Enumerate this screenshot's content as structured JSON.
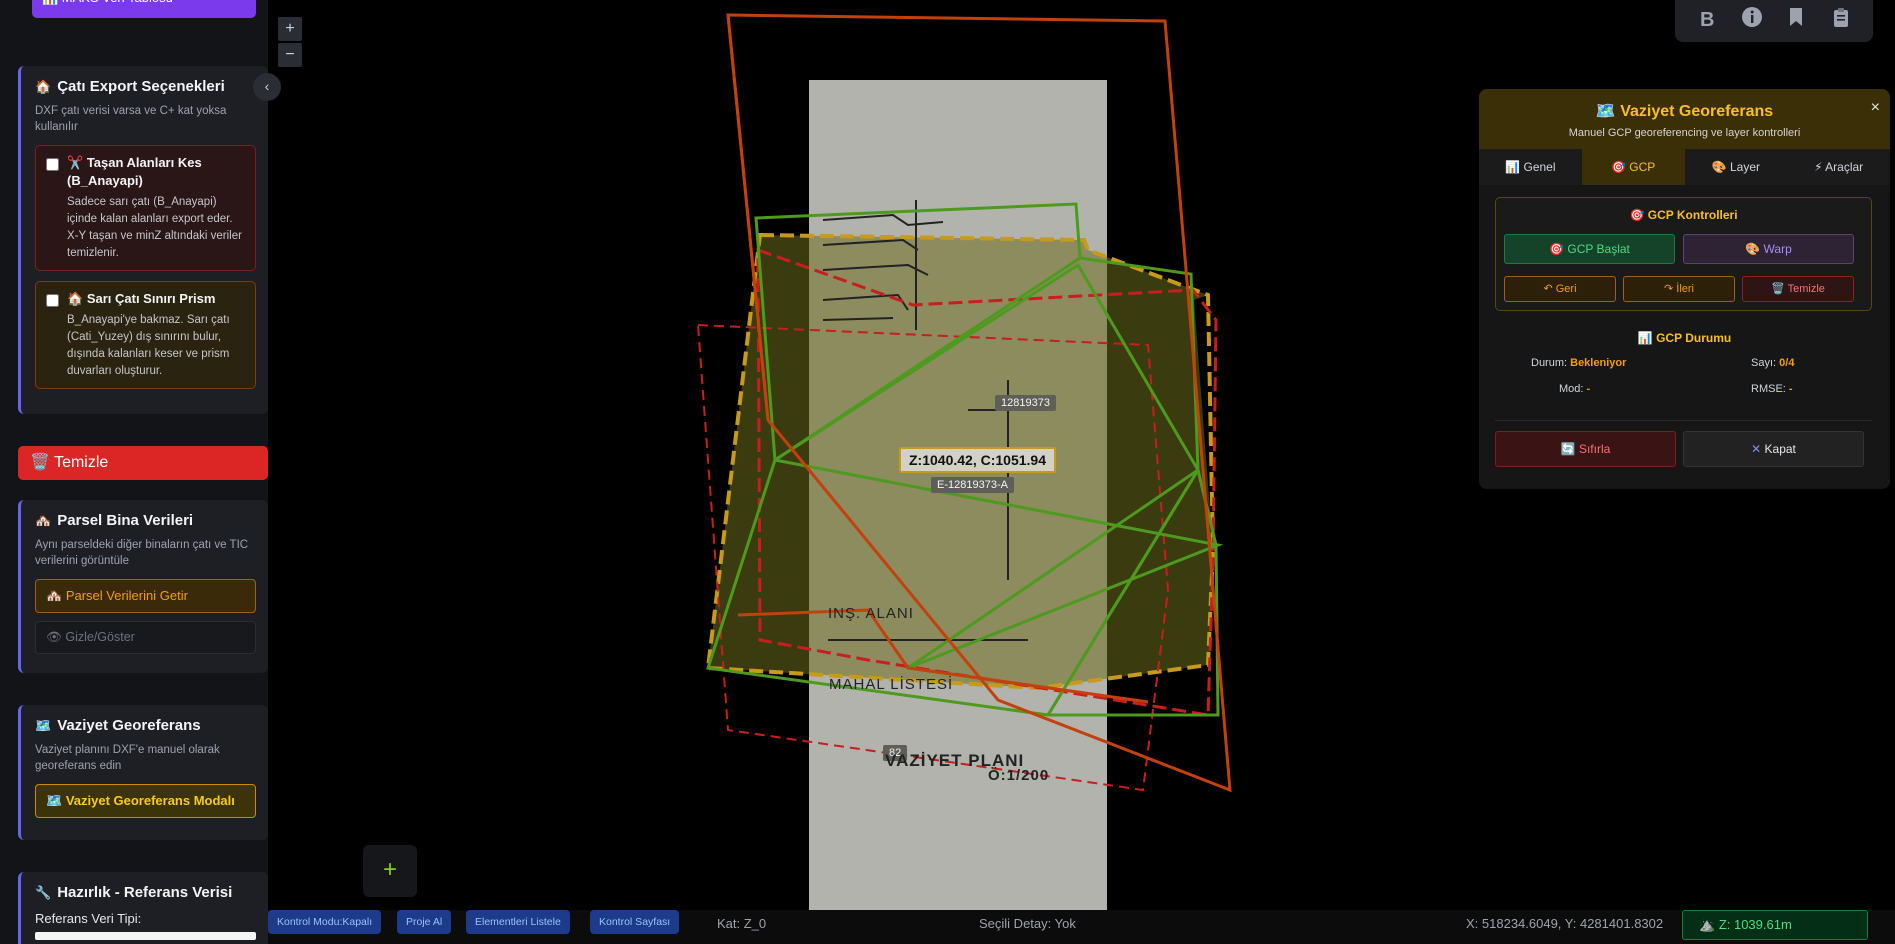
{
  "sidebar": {
    "top_button": "📊 MAKS Veri Tablosu",
    "roof_export": {
      "icon": "house-icon",
      "title": "Çatı Export Seçenekleri",
      "desc": "DXF çatı verisi varsa ve C+ kat yoksa kullanılır",
      "option1_title": "Taşan Alanları Kes (B_Anayapi)",
      "option1_desc": "Sadece sarı çatı (B_Anayapi) içinde kalan alanları export eder. X-Y taşan ve minZ altındaki veriler temizlenir.",
      "option2_title": "Sarı Çatı Sınırı Prism",
      "option2_desc": "B_Anayapi'ye bakmaz. Sarı çatı (Cati_Yuzey) dış sınırını bulur, dışında kalanları keser ve prism duvarları oluşturur."
    },
    "clear_button": "Temizle",
    "parcel": {
      "title": "Parsel Bina Verileri",
      "desc": "Aynı parseldeki diğer binaların çatı ve TIC verilerini görüntüle",
      "fetch_button": "Parsel Verilerini Getir",
      "toggle_placeholder": "Gizle/Göster"
    },
    "georef": {
      "title": "Vaziyet Georeferans",
      "desc": "Vaziyet planını DXF'e manuel olarak georeferans edin",
      "modal_button": "Vaziyet Georeferans Modalı"
    },
    "prep": {
      "title": "Hazırlık - Referans Verisi",
      "ref_type_label": "Referans Veri Tipi:"
    }
  },
  "map": {
    "zoom_in": "+",
    "zoom_out": "−",
    "add_button": "+",
    "labels": {
      "parcel_id": "12819373",
      "coords_tooltip": "Z:1040.42, C:1051.94",
      "parcel_id_a": "E-12819373-A",
      "number": "82",
      "ins_alani": "INŞ. ALANI",
      "mahal": "MAHAL LİSTESİ",
      "vaziyet": "VAZİYET PLANI",
      "scale": "Ö:1/200"
    }
  },
  "toolbar": {
    "icons": [
      "bold-b-icon",
      "info-icon",
      "bookmark-icon",
      "clipboard-icon"
    ]
  },
  "panel": {
    "title": "Vaziyet Georeferans",
    "subtitle": "Manuel GCP georeferencing ve layer kontrolleri",
    "close": "×",
    "tabs": [
      "Genel",
      "GCP",
      "Layer",
      "Araçlar"
    ],
    "active_tab": "GCP",
    "gcp_controls_title": "GCP Kontrolleri",
    "btn_start": "GCP Başlat",
    "btn_warp": "Warp",
    "btn_back": "↶ Geri",
    "btn_forward": "↷ İleri",
    "btn_clear": "Temizle",
    "status_title": "GCP Durumu",
    "status_label": "Durum:",
    "status_value": "Bekleniyor",
    "count_label": "Sayı:",
    "count_value": "0/4",
    "mode_label": "Mod:",
    "mode_value": "-",
    "rmse_label": "RMSE:",
    "rmse_value": "-",
    "btn_reset": "Sıfırla",
    "btn_close": "Kapat"
  },
  "statusbar": {
    "btn_control_mode": "Kontrol Modu:Kapalı",
    "btn_project": "Proje Al",
    "btn_elements": "Elementleri Listele",
    "btn_control_page": "Kontrol Sayfası",
    "floor": "Kat: Z_0",
    "selected": "Seçili Detay: Yok",
    "coords": "X: 518234.6049, Y: 4281401.8302",
    "z_badge": "Z: 1039.61m"
  },
  "colors": {
    "accent_yellow": "#fbbf24",
    "danger_red": "#dc2626",
    "success_green": "#4ade80",
    "sidebar_accent": "#6366f1"
  }
}
